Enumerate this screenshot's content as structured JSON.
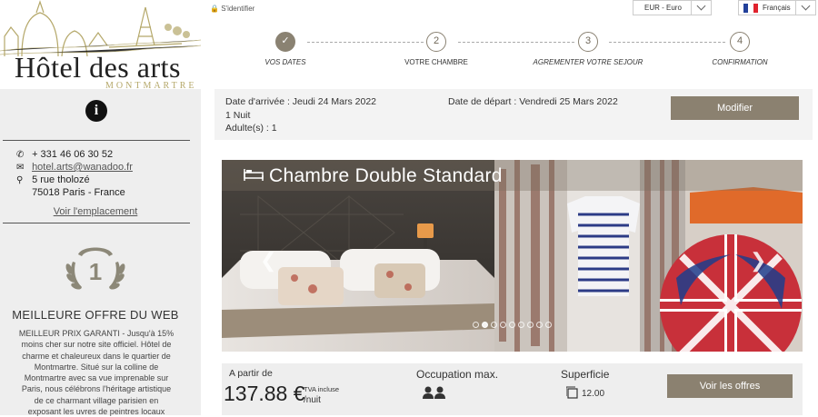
{
  "logo": {
    "title": "Hôtel des arts",
    "subtitle": "MONTMARTRE"
  },
  "topbar": {
    "login": "S'identifier",
    "currency": "EUR - Euro",
    "language": "Français"
  },
  "sidebar": {
    "phone": "+ 331 46 06 30 52",
    "email": "hotel.arts@wanadoo.fr",
    "address_line1": "5 rue tholozé",
    "address_line2": "75018 Paris - France",
    "location_link": "Voir l'emplacement",
    "award_number": "1",
    "offer_title": "MEILLEURE OFFRE DU WEB",
    "offer_text": "MEILLEUR PRIX GARANTI - Jusqu'à 15% moins cher sur notre site officiel. Hôtel de charme et chaleureux dans le quartier de Montmartre. Situé sur la colline de Montmartre avec sa vue imprenable sur Paris, nous célébrons l'héritage artistique de ce charmant village parisien en exposant les    uvres de peintres locaux"
  },
  "steps": [
    {
      "num": "✓",
      "label": "VOS DATES"
    },
    {
      "num": "2",
      "label": "VOTRE CHAMBRE"
    },
    {
      "num": "3",
      "label": "AGREMENTER VOTRE SEJOUR"
    },
    {
      "num": "4",
      "label": "CONFIRMATION"
    }
  ],
  "booking": {
    "arrival": "Date d'arrivée : Jeudi 24 Mars 2022",
    "nights": "1 Nuit",
    "adults": "Adulte(s) : 1",
    "departure": "Date de départ : Vendredi 25 Mars 2022",
    "modify_label": "Modifier"
  },
  "room": {
    "name": "Chambre Double Standard",
    "slide_count": 9,
    "active_slide": 1,
    "price_from": "A partir de",
    "price": "137.88 €",
    "tva": "TVA incluse",
    "per_night": "/nuit",
    "occupancy_label": "Occupation max.",
    "surface_label": "Superficie",
    "surface_value": "12.00",
    "offers_label": "Voir les offres"
  }
}
